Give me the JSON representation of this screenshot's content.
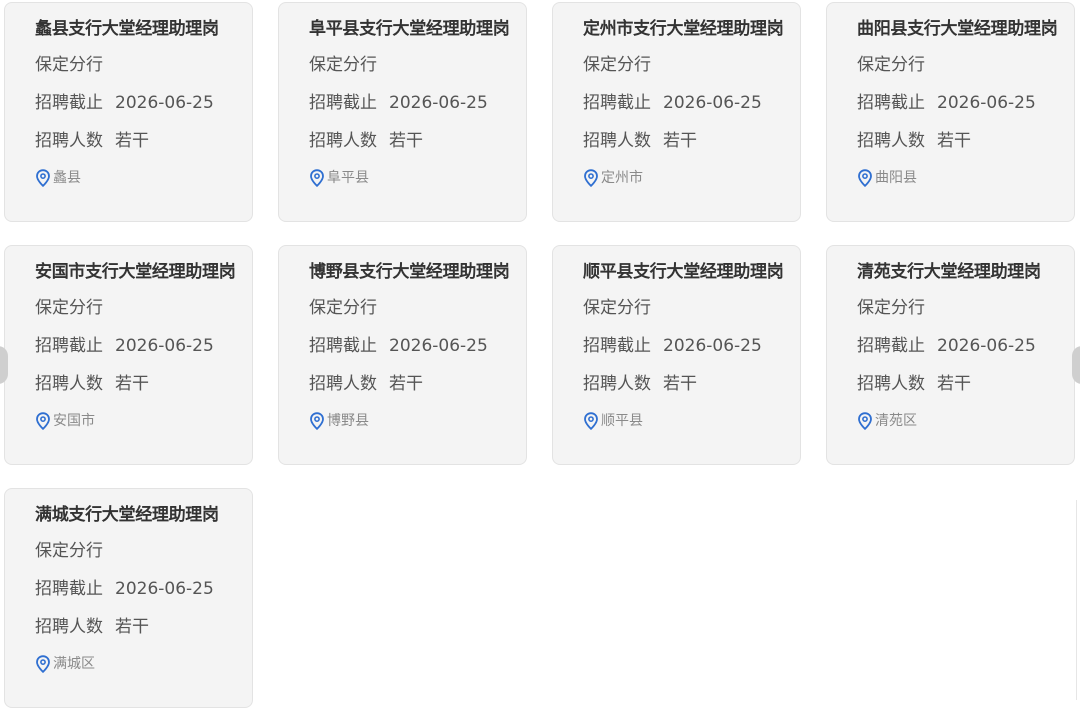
{
  "jobs": [
    {
      "title": "蠡县支行大堂经理助理岗",
      "branch": "保定分行",
      "deadline_label": "招聘截止",
      "deadline": "2026-06-25",
      "count_label": "招聘人数",
      "count": "若干",
      "location": "蠡县"
    },
    {
      "title": "阜平县支行大堂经理助理岗",
      "branch": "保定分行",
      "deadline_label": "招聘截止",
      "deadline": "2026-06-25",
      "count_label": "招聘人数",
      "count": "若干",
      "location": "阜平县"
    },
    {
      "title": "定州市支行大堂经理助理岗",
      "branch": "保定分行",
      "deadline_label": "招聘截止",
      "deadline": "2026-06-25",
      "count_label": "招聘人数",
      "count": "若干",
      "location": "定州市"
    },
    {
      "title": "曲阳县支行大堂经理助理岗",
      "branch": "保定分行",
      "deadline_label": "招聘截止",
      "deadline": "2026-06-25",
      "count_label": "招聘人数",
      "count": "若干",
      "location": "曲阳县"
    },
    {
      "title": "安国市支行大堂经理助理岗",
      "branch": "保定分行",
      "deadline_label": "招聘截止",
      "deadline": "2026-06-25",
      "count_label": "招聘人数",
      "count": "若干",
      "location": "安国市"
    },
    {
      "title": "博野县支行大堂经理助理岗",
      "branch": "保定分行",
      "deadline_label": "招聘截止",
      "deadline": "2026-06-25",
      "count_label": "招聘人数",
      "count": "若干",
      "location": "博野县"
    },
    {
      "title": "顺平县支行大堂经理助理岗",
      "branch": "保定分行",
      "deadline_label": "招聘截止",
      "deadline": "2026-06-25",
      "count_label": "招聘人数",
      "count": "若干",
      "location": "顺平县"
    },
    {
      "title": "清苑支行大堂经理助理岗",
      "branch": "保定分行",
      "deadline_label": "招聘截止",
      "deadline": "2026-06-25",
      "count_label": "招聘人数",
      "count": "若干",
      "location": "清苑区"
    },
    {
      "title": "满城支行大堂经理助理岗",
      "branch": "保定分行",
      "deadline_label": "招聘截止",
      "deadline": "2026-06-25",
      "count_label": "招聘人数",
      "count": "若干",
      "location": "满城区"
    }
  ],
  "icons": {
    "location": "map-pin-icon",
    "prev": "chevron-left-icon",
    "next": "chevron-right-icon"
  },
  "colors": {
    "card_bg": "#f4f4f4",
    "card_border": "#e3e3e3",
    "title": "#333333",
    "text": "#555555",
    "location_text": "#8a8a8a",
    "pin": "#2f6fd1"
  }
}
